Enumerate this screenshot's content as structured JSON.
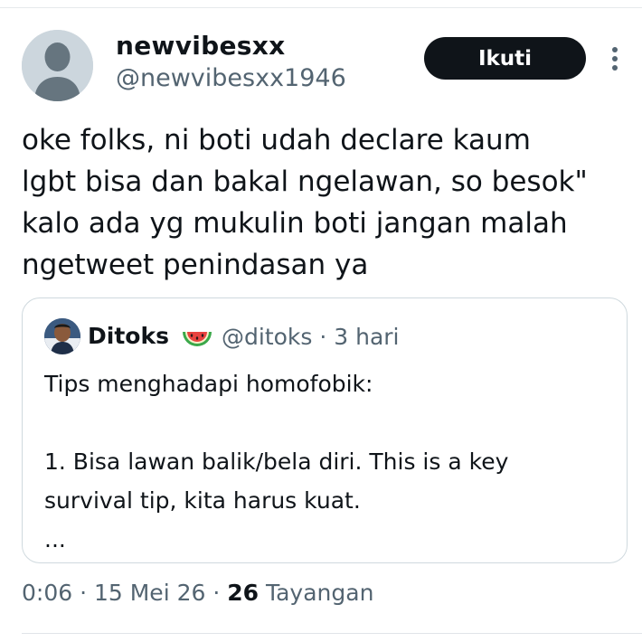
{
  "author": {
    "display_name": "newvibesxx",
    "handle": "@newvibesxx1946"
  },
  "follow_button_label": "Ikuti",
  "tweet_lines": [
    "oke folks, ni boti udah declare kaum",
    "lgbt bisa dan bakal ngelawan, so besok\"",
    "kalo ada yg mukulin boti jangan malah",
    "ngetweet penindasan ya"
  ],
  "quoted_tweet": {
    "display_name": "Ditoks",
    "name_emoji": "watermelon-icon",
    "meta": "@ditoks · 3 hari",
    "lines": [
      "Tips menghadapi homofobik:",
      "",
      "1. Bisa lawan balik/bela diri. This is a key",
      "survival tip, kita harus kuat.",
      "..."
    ]
  },
  "footer": {
    "time_date": "0:06 · 15 Mei 26 · ",
    "views_count": "26",
    "views_label": " Tayangan"
  },
  "colors": {
    "text_primary": "#0f1419",
    "text_secondary": "#536471",
    "follow_button_bg": "#0f1419",
    "border": "#cfd9de"
  }
}
